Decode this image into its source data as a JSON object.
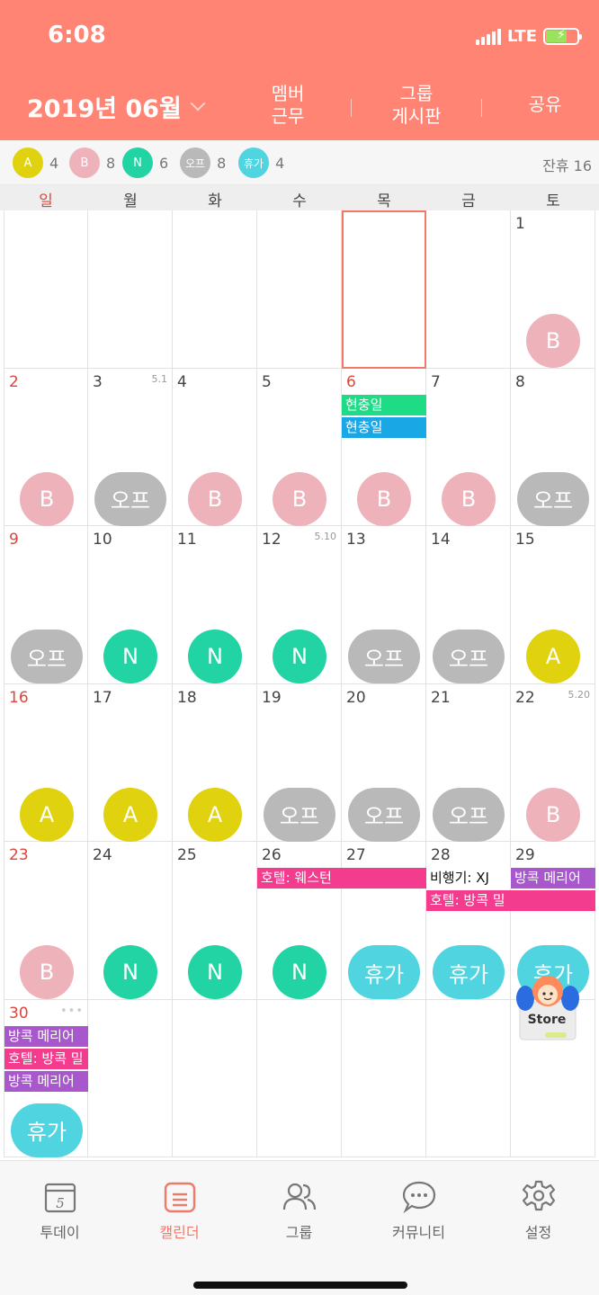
{
  "status": {
    "time": "6:08",
    "network": "LTE"
  },
  "colors": {
    "header_bg": "#ff8473",
    "A": "#e0d20e",
    "B": "#eeb2bb",
    "N": "#22d3a3",
    "off": "#b9b9b9",
    "vac": "#50d4e0",
    "event_green": "#1edb85",
    "event_blue": "#1aa7e6",
    "event_pink": "#f33c8d",
    "event_purple": "#a858cc",
    "sunday": "#e0443a"
  },
  "header": {
    "month": "2019년 06월",
    "buttons": [
      "멤버\n근무",
      "그룹\n게시판",
      "공유"
    ]
  },
  "summary": {
    "items": [
      {
        "label": "A",
        "count": "4",
        "kind": "A"
      },
      {
        "label": "B",
        "count": "8",
        "kind": "B"
      },
      {
        "label": "N",
        "count": "6",
        "kind": "N"
      },
      {
        "label": "오프",
        "count": "8",
        "kind": "off"
      },
      {
        "label": "휴가",
        "count": "4",
        "kind": "vac"
      }
    ],
    "remaining": "잔휴 16"
  },
  "weekdays": [
    "일",
    "월",
    "화",
    "수",
    "목",
    "금",
    "토"
  ],
  "calendar": {
    "weeks": [
      [
        {
          "day": "",
          "shift": "",
          "kind": "",
          "lunar": "",
          "events": []
        },
        {
          "day": "",
          "shift": "",
          "kind": "",
          "lunar": "",
          "events": []
        },
        {
          "day": "",
          "shift": "",
          "kind": "",
          "lunar": "",
          "events": []
        },
        {
          "day": "",
          "shift": "",
          "kind": "",
          "lunar": "",
          "events": []
        },
        {
          "day": "",
          "shift": "",
          "kind": "",
          "lunar": "",
          "events": [],
          "today": true
        },
        {
          "day": "",
          "shift": "",
          "kind": "",
          "lunar": "",
          "events": []
        },
        {
          "day": "1",
          "shift": "B",
          "kind": "B",
          "lunar": "",
          "events": []
        }
      ],
      [
        {
          "day": "2",
          "shift": "B",
          "kind": "B",
          "lunar": "",
          "events": []
        },
        {
          "day": "3",
          "shift": "오프",
          "kind": "off",
          "lunar": "5.1",
          "events": []
        },
        {
          "day": "4",
          "shift": "B",
          "kind": "B",
          "lunar": "",
          "events": []
        },
        {
          "day": "5",
          "shift": "B",
          "kind": "B",
          "lunar": "",
          "events": []
        },
        {
          "day": "6",
          "shift": "B",
          "kind": "B",
          "lunar": "",
          "red": true,
          "events": [
            {
              "text": "현충일",
              "color": "#1edb85"
            },
            {
              "text": "현충일",
              "color": "#1aa7e6"
            }
          ]
        },
        {
          "day": "7",
          "shift": "B",
          "kind": "B",
          "lunar": "",
          "events": []
        },
        {
          "day": "8",
          "shift": "오프",
          "kind": "off",
          "lunar": "",
          "events": []
        }
      ],
      [
        {
          "day": "9",
          "shift": "오프",
          "kind": "off",
          "lunar": "",
          "events": []
        },
        {
          "day": "10",
          "shift": "N",
          "kind": "N",
          "lunar": "",
          "events": []
        },
        {
          "day": "11",
          "shift": "N",
          "kind": "N",
          "lunar": "",
          "events": []
        },
        {
          "day": "12",
          "shift": "N",
          "kind": "N",
          "lunar": "5.10",
          "events": []
        },
        {
          "day": "13",
          "shift": "오프",
          "kind": "off",
          "lunar": "",
          "events": []
        },
        {
          "day": "14",
          "shift": "오프",
          "kind": "off",
          "lunar": "",
          "events": []
        },
        {
          "day": "15",
          "shift": "A",
          "kind": "A",
          "lunar": "",
          "events": []
        }
      ],
      [
        {
          "day": "16",
          "shift": "A",
          "kind": "A",
          "lunar": "",
          "events": []
        },
        {
          "day": "17",
          "shift": "A",
          "kind": "A",
          "lunar": "",
          "events": []
        },
        {
          "day": "18",
          "shift": "A",
          "kind": "A",
          "lunar": "",
          "events": []
        },
        {
          "day": "19",
          "shift": "오프",
          "kind": "off",
          "lunar": "",
          "events": []
        },
        {
          "day": "20",
          "shift": "오프",
          "kind": "off",
          "lunar": "",
          "events": []
        },
        {
          "day": "21",
          "shift": "오프",
          "kind": "off",
          "lunar": "",
          "events": []
        },
        {
          "day": "22",
          "shift": "B",
          "kind": "B",
          "lunar": "5.20",
          "events": []
        }
      ],
      [
        {
          "day": "23",
          "shift": "B",
          "kind": "B",
          "lunar": "",
          "events": []
        },
        {
          "day": "24",
          "shift": "N",
          "kind": "N",
          "lunar": "",
          "events": []
        },
        {
          "day": "25",
          "shift": "N",
          "kind": "N",
          "lunar": "",
          "events": []
        },
        {
          "day": "26",
          "shift": "N",
          "kind": "N",
          "lunar": "",
          "events": [
            {
              "text": "호텔: 웨스턴",
              "color": "#f33c8d"
            }
          ]
        },
        {
          "day": "27",
          "shift": "휴가",
          "kind": "vac",
          "lunar": "",
          "events": [
            {
              "text": "",
              "color": "#f33c8d"
            }
          ]
        },
        {
          "day": "28",
          "shift": "휴가",
          "kind": "vac",
          "lunar": "",
          "events": [
            {
              "text": "비행기: XJ",
              "color": "#ffffff",
              "dark": true
            },
            {
              "text": "호텔: 방콕 밀",
              "color": "#f33c8d"
            }
          ]
        },
        {
          "day": "29",
          "shift": "휴가",
          "kind": "vac",
          "lunar": "",
          "events": [
            {
              "text": "방콕 메리어",
              "color": "#a858cc"
            },
            {
              "text": "",
              "color": "#f33c8d"
            }
          ]
        }
      ],
      [
        {
          "day": "30",
          "shift": "휴가",
          "kind": "vac",
          "lunar": "",
          "more": "•••",
          "events": [
            {
              "text": "방콕 메리어",
              "color": "#a858cc"
            },
            {
              "text": "호텔: 방콕 밀",
              "color": "#f33c8d"
            },
            {
              "text": "방콕 메리어",
              "color": "#a858cc"
            }
          ]
        },
        {
          "day": "",
          "shift": "",
          "kind": "",
          "lunar": "",
          "events": []
        },
        {
          "day": "",
          "shift": "",
          "kind": "",
          "lunar": "",
          "events": []
        },
        {
          "day": "",
          "shift": "",
          "kind": "",
          "lunar": "",
          "events": []
        },
        {
          "day": "",
          "shift": "",
          "kind": "",
          "lunar": "",
          "events": []
        },
        {
          "day": "",
          "shift": "",
          "kind": "",
          "lunar": "",
          "events": []
        },
        {
          "day": "",
          "shift": "",
          "kind": "",
          "lunar": "",
          "events": []
        }
      ]
    ]
  },
  "store": {
    "label": "Store"
  },
  "tabbar": {
    "items": [
      {
        "label": "투데이",
        "icon": "today-icon",
        "badge": "5"
      },
      {
        "label": "캘린더",
        "icon": "calendar-icon",
        "active": true
      },
      {
        "label": "그룹",
        "icon": "group-icon"
      },
      {
        "label": "커뮤니티",
        "icon": "chat-bubble-icon"
      },
      {
        "label": "설정",
        "icon": "gear-icon"
      }
    ]
  }
}
